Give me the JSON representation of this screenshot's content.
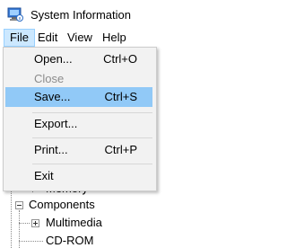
{
  "window": {
    "title": "System Information"
  },
  "menubar": {
    "items": [
      {
        "label": "File"
      },
      {
        "label": "Edit"
      },
      {
        "label": "View"
      },
      {
        "label": "Help"
      }
    ]
  },
  "file_menu": {
    "items": [
      {
        "label": "Open...",
        "shortcut": "Ctrl+O",
        "enabled": true
      },
      {
        "label": "Close",
        "shortcut": "",
        "enabled": false
      },
      {
        "label": "Save...",
        "shortcut": "Ctrl+S",
        "enabled": true,
        "highlighted": true
      },
      {
        "label": "Export...",
        "shortcut": "",
        "enabled": true
      },
      {
        "label": "Print...",
        "shortcut": "Ctrl+P",
        "enabled": true
      },
      {
        "label": "Exit",
        "shortcut": "",
        "enabled": true
      }
    ]
  },
  "tree": {
    "items": [
      {
        "label": "Memory"
      },
      {
        "label": "Components",
        "expanded": true
      },
      {
        "label": "Multimedia",
        "expanded": false
      },
      {
        "label": "CD-ROM"
      }
    ]
  },
  "colors": {
    "menu_highlight": "#91c9f7",
    "menubar_active": "#cce8ff",
    "menu_background": "#f2f2f2",
    "disabled_text": "#8c8c8c"
  }
}
